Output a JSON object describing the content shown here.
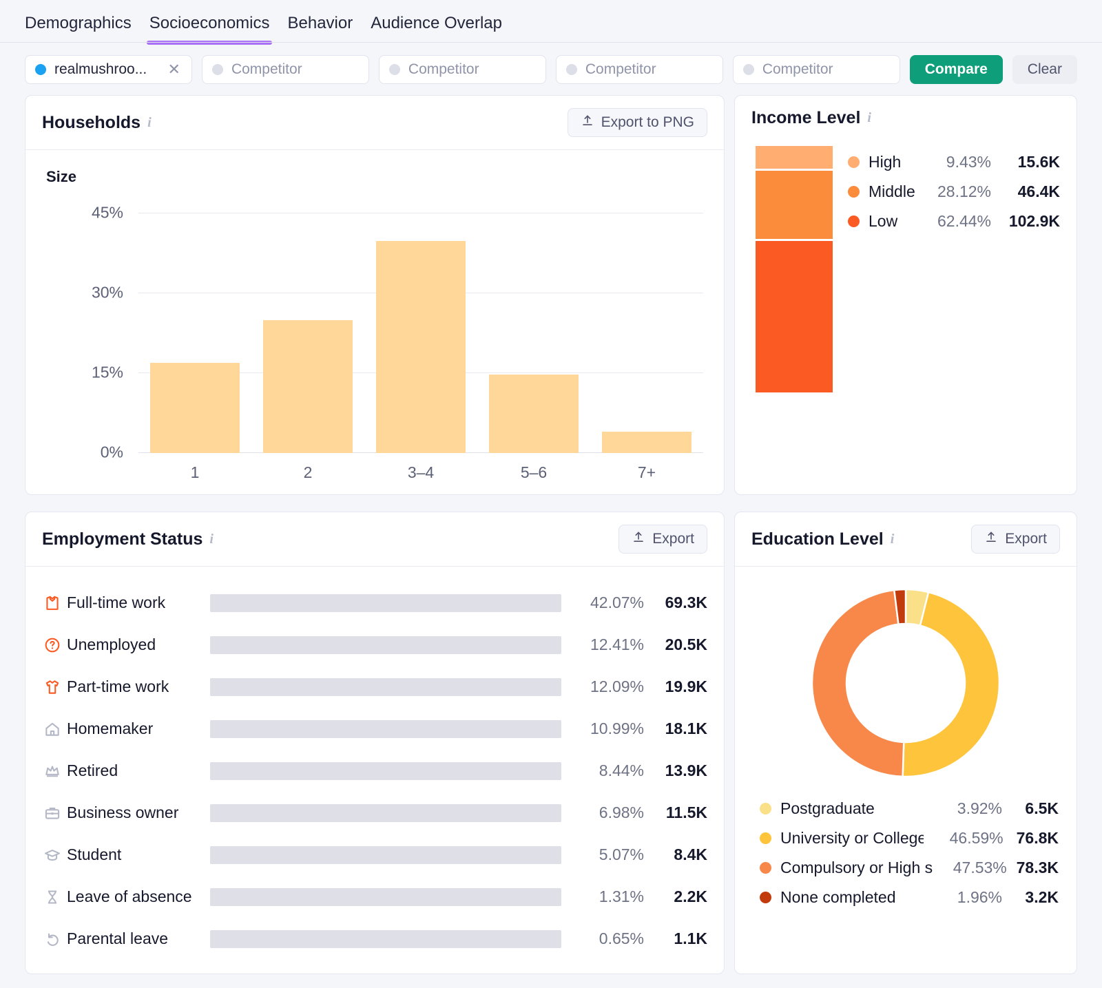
{
  "tabs": [
    {
      "label": "Demographics",
      "active": false
    },
    {
      "label": "Socioeconomics",
      "active": true
    },
    {
      "label": "Behavior",
      "active": false
    },
    {
      "label": "Audience Overlap",
      "active": false
    }
  ],
  "compare_bar": {
    "domain_pill": {
      "label": "realmushroo...",
      "dot_color": "#1ba1f2",
      "remove_icon": "close-icon"
    },
    "competitor_placeholder": "Competitor",
    "competitor_slots": 4,
    "compare_label": "Compare",
    "clear_label": "Clear",
    "compare_color": "#0f9e7a"
  },
  "households": {
    "title": "Households",
    "info_icon": "info-icon",
    "export_label": "Export to PNG",
    "export_icon": "upload-icon",
    "size_title": "Size"
  },
  "income": {
    "title": "Income Level",
    "info_icon": "info-icon"
  },
  "employment": {
    "title": "Employment Status",
    "info_icon": "info-icon",
    "export_label": "Export",
    "export_icon": "upload-icon"
  },
  "education": {
    "title": "Education Level",
    "info_icon": "info-icon",
    "export_label": "Export",
    "export_icon": "upload-icon"
  },
  "chart_data": [
    {
      "id": "household-size",
      "type": "bar",
      "title": "Size",
      "xlabel": "",
      "ylabel": "",
      "categories": [
        "1",
        "2",
        "3–4",
        "5–6",
        "7+"
      ],
      "values": [
        17.0,
        25.0,
        39.8,
        14.8,
        4.0
      ],
      "ylim": [
        0,
        45
      ],
      "yticks": [
        0,
        15,
        30,
        45
      ],
      "ytick_labels": [
        "0%",
        "15%",
        "30%",
        "45%"
      ],
      "grid": true,
      "legend": "none",
      "bar_color": "#ffd899"
    },
    {
      "id": "income-level",
      "type": "bar",
      "subtype": "stacked-vertical",
      "title": "Income Level",
      "categories": [
        "High",
        "Middle",
        "Low"
      ],
      "values": [
        9.43,
        28.12,
        62.44
      ],
      "value_labels": [
        "9.43%",
        "28.12%",
        "62.44%"
      ],
      "counts": [
        "15.6K",
        "46.4K",
        "102.9K"
      ],
      "colors": [
        "#ffad70",
        "#fb8c3c",
        "#fb5a22"
      ],
      "legend": "right"
    },
    {
      "id": "employment-status",
      "type": "bar",
      "subtype": "horizontal",
      "title": "Employment Status",
      "categories": [
        "Full-time work",
        "Unemployed",
        "Part-time work",
        "Homemaker",
        "Retired",
        "Business owner",
        "Student",
        "Leave of absence",
        "Parental leave"
      ],
      "values": [
        42.07,
        12.41,
        12.09,
        10.99,
        8.44,
        6.98,
        5.07,
        1.31,
        0.65
      ],
      "value_labels": [
        "42.07%",
        "12.41%",
        "12.09%",
        "10.99%",
        "8.44%",
        "6.98%",
        "5.07%",
        "1.31%",
        "0.65%"
      ],
      "counts": [
        "69.3K",
        "20.5K",
        "19.9K",
        "18.1K",
        "13.9K",
        "11.5K",
        "8.4K",
        "2.2K",
        "1.1K"
      ],
      "icons": [
        "shirt-icon",
        "question-circle-icon",
        "tshirt-icon",
        "house-icon",
        "crown-icon",
        "briefcase-icon",
        "graduation-cap-icon",
        "hourglass-icon",
        "return-arrow-icon"
      ],
      "icon_colors": [
        "#fb5a22",
        "#fb5a22",
        "#fb5a22",
        "#b3b7c6",
        "#b3b7c6",
        "#b3b7c6",
        "#b3b7c6",
        "#b3b7c6",
        "#b3b7c6"
      ],
      "bar_color": "#fdbe3b",
      "track_color": "#dedfe7",
      "xlim": [
        0,
        100
      ],
      "grid": false,
      "legend": "none"
    },
    {
      "id": "education-level",
      "type": "pie",
      "subtype": "donut",
      "title": "Education Level",
      "labels": [
        "Postgraduate",
        "University or College",
        "Compulsory or High s...",
        "None completed"
      ],
      "values": [
        3.92,
        46.59,
        47.53,
        1.96
      ],
      "value_labels": [
        "3.92%",
        "46.59%",
        "47.53%",
        "1.96%"
      ],
      "counts": [
        "6.5K",
        "76.8K",
        "78.3K",
        "3.2K"
      ],
      "colors": [
        "#fbe08a",
        "#fdc43c",
        "#f8874a",
        "#c23b0c"
      ],
      "legend": "bottom"
    }
  ]
}
